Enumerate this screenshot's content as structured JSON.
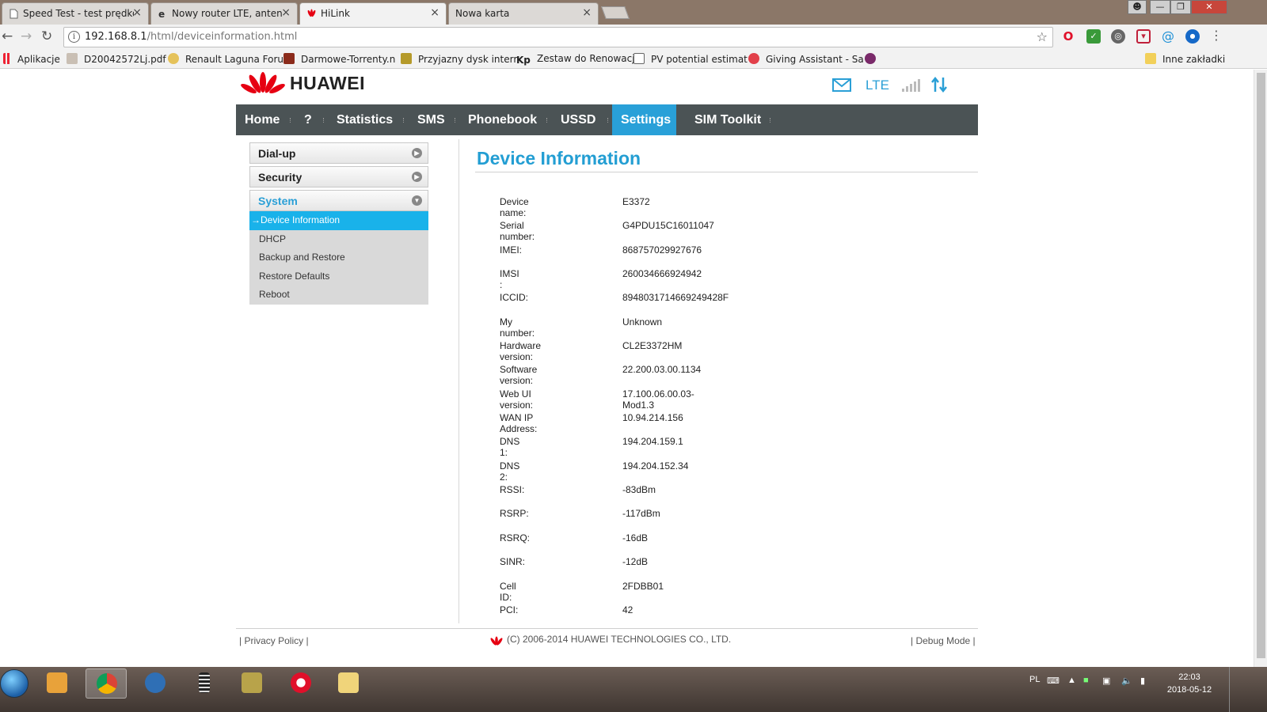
{
  "browser": {
    "tabs": [
      {
        "title": "Speed Test - test prędkoś",
        "active": false
      },
      {
        "title": "Nowy router LTE, antena",
        "active": false
      },
      {
        "title": "HiLink",
        "active": true
      },
      {
        "title": "Nowa karta",
        "active": false
      }
    ],
    "url_host": "192.168.8.1",
    "url_path": "/html/deviceinformation.html",
    "bookmarks": [
      {
        "label": "Aplikacje",
        "icon": "apps-grid-icon"
      },
      {
        "label": "D20042572Lj.pdf",
        "icon": "pdf-icon"
      },
      {
        "label": "Renault Laguna Foru",
        "icon": "forum-icon"
      },
      {
        "label": "Darmowe-Torrenty.n",
        "icon": "torrent-icon"
      },
      {
        "label": "Przyjazny dysk interr",
        "icon": "disk-icon"
      },
      {
        "label": "Zestaw do Renowacj",
        "icon": "kp-icon"
      },
      {
        "label": "PV potential estimat",
        "icon": "page-icon"
      },
      {
        "label": "Giving Assistant - Sa",
        "icon": "giving-icon"
      }
    ],
    "other_bookmarks": "Inne zakładki"
  },
  "header": {
    "brand": "HUAWEI",
    "network_type": "LTE",
    "icons": [
      "envelope-icon",
      "signal-bars-icon",
      "data-arrows-icon"
    ]
  },
  "nav": {
    "items": [
      {
        "label": "Home",
        "active": false
      },
      {
        "label": "?",
        "active": false
      },
      {
        "label": "Statistics",
        "active": false
      },
      {
        "label": "SMS",
        "active": false
      },
      {
        "label": "Phonebook",
        "active": false
      },
      {
        "label": "USSD",
        "active": false
      },
      {
        "label": "Settings",
        "active": true
      },
      {
        "label": "SIM Toolkit",
        "active": false
      }
    ]
  },
  "sidebar": {
    "sections": [
      {
        "label": "Dial-up",
        "open": false
      },
      {
        "label": "Security",
        "open": false
      },
      {
        "label": "System",
        "open": true
      }
    ],
    "active_marker": "→",
    "subitems": [
      {
        "label": "Device Information",
        "active": true
      },
      {
        "label": "DHCP",
        "active": false
      },
      {
        "label": "Backup and Restore",
        "active": false
      },
      {
        "label": "Restore Defaults",
        "active": false
      },
      {
        "label": "Reboot",
        "active": false
      }
    ]
  },
  "content": {
    "title": "Device Information",
    "rows": [
      {
        "label": "Device name:",
        "value": "E3372"
      },
      {
        "label": "Serial number:",
        "value": "G4PDU15C16011047"
      },
      {
        "label": "IMEI:",
        "value": "868757029927676"
      },
      {
        "label": "IMSI :",
        "value": "260034666924942"
      },
      {
        "label": "ICCID:",
        "value": "8948031714669249428F"
      },
      {
        "label": "My number:",
        "value": "Unknown"
      },
      {
        "label": "Hardware version:",
        "value": "CL2E3372HM"
      },
      {
        "label": "Software version:",
        "value": "22.200.03.00.1134"
      },
      {
        "label": "Web UI version:",
        "value": "17.100.06.00.03-Mod1.3"
      },
      {
        "label": "WAN IP Address:",
        "value": "10.94.214.156"
      },
      {
        "label": "DNS 1:",
        "value": "194.204.159.1"
      },
      {
        "label": "DNS 2:",
        "value": "194.204.152.34"
      },
      {
        "label": "RSSI:",
        "value": "-83dBm"
      },
      {
        "label": "RSRP:",
        "value": "-117dBm"
      },
      {
        "label": "RSRQ:",
        "value": "-16dB"
      },
      {
        "label": "SINR:",
        "value": "-12dB"
      },
      {
        "label": "Cell ID:",
        "value": "2FDBB01"
      },
      {
        "label": "PCI:",
        "value": "42"
      }
    ]
  },
  "footer": {
    "privacy": "Privacy Policy",
    "copyright": "(C) 2006-2014 HUAWEI TECHNOLOGIES CO., LTD.",
    "debug": "Debug Mode"
  },
  "taskbar": {
    "language": "PL",
    "time": "22:03",
    "date": "2018-05-12"
  },
  "colors": {
    "accent": "#29a0d8",
    "nav_bg": "#4b5355",
    "active_subitem": "#19b2ea",
    "brand_red": "#e60012"
  }
}
